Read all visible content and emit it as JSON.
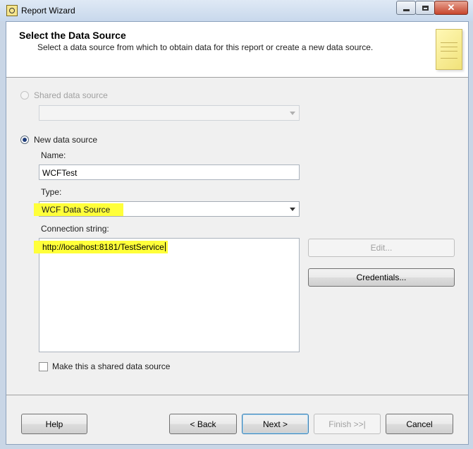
{
  "window": {
    "title": "Report Wizard",
    "close_label": "✕"
  },
  "header": {
    "title": "Select the Data Source",
    "subtitle": "Select a data source from which to obtain data for this report or create a new data source."
  },
  "shared_source": {
    "label": "Shared data source",
    "selected": false,
    "enabled": false,
    "combo_value": ""
  },
  "new_source": {
    "label": "New data source",
    "selected": true,
    "name_label": "Name:",
    "name_value": "WCFTest",
    "type_label": "Type:",
    "type_value": "WCF Data Source",
    "connection_label": "Connection string:",
    "connection_value": "http://localhost:8181/TestService",
    "edit_label": "Edit...",
    "credentials_label": "Credentials...",
    "make_shared_label": "Make this a shared data source",
    "make_shared_checked": false
  },
  "footer": {
    "help_label": "Help",
    "back_label": "< Back",
    "next_label": "Next >",
    "finish_label": "Finish >>|",
    "cancel_label": "Cancel"
  },
  "colors": {
    "highlight": "#ffff3a",
    "window_frame": "#c9d6e6"
  }
}
